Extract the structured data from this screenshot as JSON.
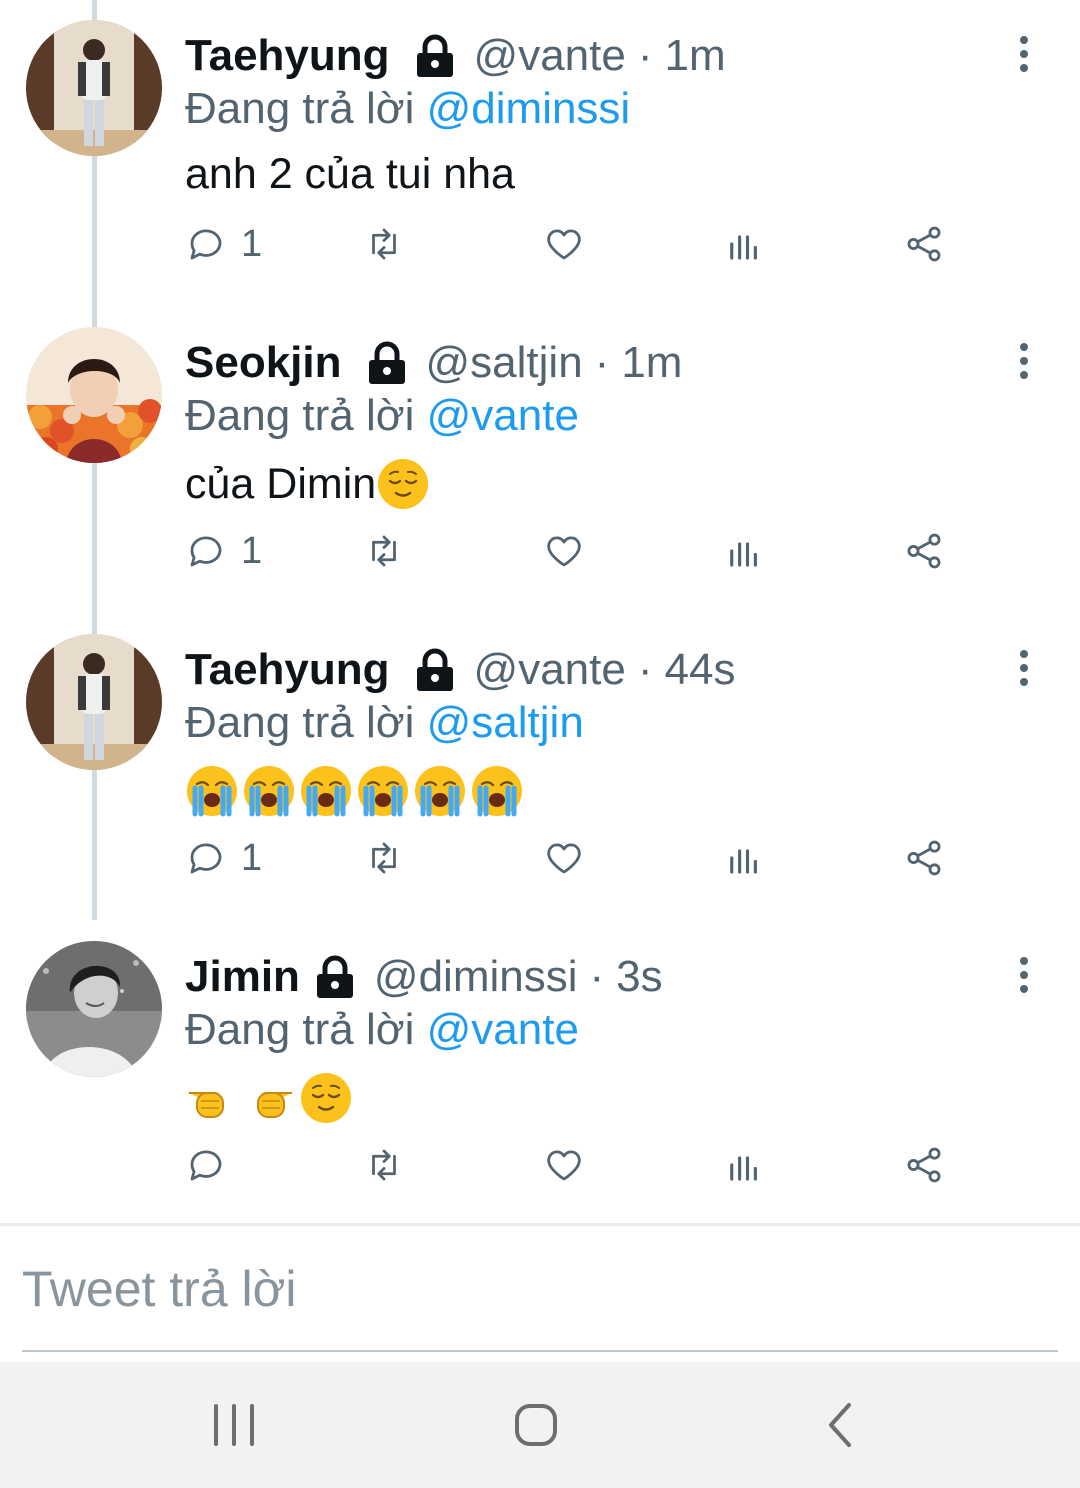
{
  "tweets": [
    {
      "name": "Taehyung",
      "handle": "@vante",
      "separator": "·",
      "time": "1m",
      "reply_prefix": "Đang trả lời",
      "reply_to": "@diminssi",
      "text": "anh 2 của tui nha",
      "reply_count": "1",
      "avatar": "taehyung-mirror-photo"
    },
    {
      "name": "Seokjin",
      "handle": "@saltjin",
      "separator": "·",
      "time": "1m",
      "reply_prefix": "Đang trả lời",
      "reply_to": "@vante",
      "text": "của Dimin",
      "text_emojis": [
        "relieved-face"
      ],
      "reply_count": "1",
      "avatar": "seokjin-flowers-photo"
    },
    {
      "name": "Taehyung",
      "handle": "@vante",
      "separator": "·",
      "time": "44s",
      "reply_prefix": "Đang trả lời",
      "reply_to": "@saltjin",
      "text": "",
      "text_emojis": [
        "loudly-crying-face",
        "loudly-crying-face",
        "loudly-crying-face",
        "loudly-crying-face",
        "loudly-crying-face",
        "loudly-crying-face"
      ],
      "reply_count": "1",
      "avatar": "taehyung-mirror-photo"
    },
    {
      "name": "Jimin",
      "handle": "@diminssi",
      "separator": "·",
      "time": "3s",
      "reply_prefix": "Đang trả lời",
      "reply_to": "@vante",
      "text": "",
      "text_emojis": [
        "pointing-right",
        "pointing-left",
        "relieved-face"
      ],
      "reply_count": "",
      "avatar": "jimin-bw-photo"
    }
  ],
  "action_icons": [
    "reply-icon",
    "retweet-icon",
    "like-icon",
    "analytics-icon",
    "share-icon"
  ],
  "compose": {
    "placeholder": "Tweet trả lời"
  },
  "navbar": {
    "icons": [
      "recent-apps-icon",
      "home-icon",
      "back-icon"
    ]
  },
  "colors": {
    "mention": "#1d9bf0",
    "secondary_text": "#536471",
    "thread_line": "#cfd9de",
    "navbar_bg": "#f2f2f2"
  }
}
